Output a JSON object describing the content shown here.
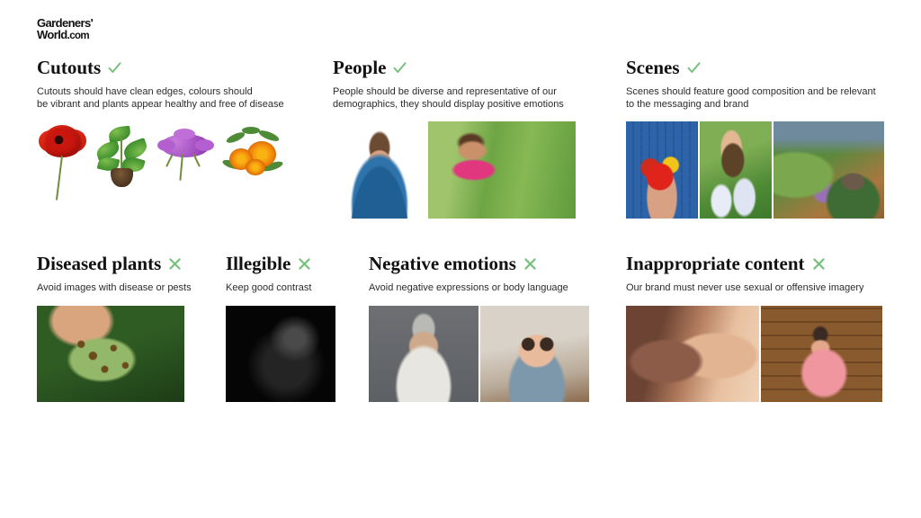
{
  "brand": {
    "line1": "Gardeners'",
    "line2": "World",
    "suffix": ".com"
  },
  "marks": {
    "tick": "check-mark",
    "cross": "cross-mark",
    "green": "#74c079"
  },
  "sections": [
    {
      "id": "cutouts",
      "title": "Cutouts",
      "mark": "tick",
      "description": "Cutouts should have clean edges, colours should\nbe vibrant and plants appear healthy and free of disease",
      "images": [
        {
          "name": "cutout-red-poppy",
          "alt": "Red poppy flower cutout"
        },
        {
          "name": "cutout-basil-plant",
          "alt": "Green basil plant with root ball cutout"
        },
        {
          "name": "cutout-purple-verbena",
          "alt": "Purple verbena flower cutout"
        },
        {
          "name": "cutout-orange-marigold",
          "alt": "Orange marigold flowers cutout"
        }
      ]
    },
    {
      "id": "people",
      "title": "People",
      "mark": "tick",
      "description": "People should be diverse and representative of our\ndemographics, they should display positive emotions",
      "images": [
        {
          "name": "photo-smiling-man-denim-shirt",
          "alt": "Smiling man in blue denim shirt on white background"
        },
        {
          "name": "photo-woman-picking-peas",
          "alt": "Smiling woman in pink top picking peas in a garden"
        }
      ]
    },
    {
      "id": "scenes",
      "title": "Scenes",
      "mark": "tick",
      "description": "Scenes should feature good composition and be relevant\nto the messaging and brand",
      "images": [
        {
          "name": "photo-hands-holding-tomatoes",
          "alt": "Hands holding freshly picked tomatoes"
        },
        {
          "name": "photo-hand-with-compost",
          "alt": "Gloved hand sprinkling compost over flowers"
        },
        {
          "name": "photo-formal-garden-fountain",
          "alt": "Formal garden with fountain and greenhouse"
        }
      ]
    },
    {
      "id": "diseased-plants",
      "title": "Diseased plants",
      "mark": "cross",
      "description": "Avoid images with disease or pests",
      "images": [
        {
          "name": "photo-diseased-leaf-spots",
          "alt": "Hand holding a leaf covered in brown disease spots"
        }
      ]
    },
    {
      "id": "illegible",
      "title": "Illegible",
      "mark": "cross",
      "description": "Keep good contrast",
      "images": [
        {
          "name": "photo-dark-unreadable",
          "alt": "Very dark low contrast photograph"
        }
      ]
    },
    {
      "id": "negative-emotions",
      "title": "Negative emotions",
      "mark": "cross",
      "description": "Avoid negative expressions or body language",
      "images": [
        {
          "name": "photo-grumpy-older-man",
          "alt": "Grumpy older man frowning against grey background"
        },
        {
          "name": "photo-bored-girl-glasses",
          "alt": "Bored girl in glasses resting chin on hands"
        }
      ]
    },
    {
      "id": "inappropriate-content",
      "title": "Inappropriate content",
      "mark": "cross",
      "description": "Our brand must never use sexual or offensive imagery",
      "images": [
        {
          "name": "photo-couple-kissing",
          "alt": "Close up of a couple kissing"
        },
        {
          "name": "photo-woman-rude-gesture",
          "alt": "Older woman in pink making a rude hand gesture"
        }
      ]
    }
  ]
}
